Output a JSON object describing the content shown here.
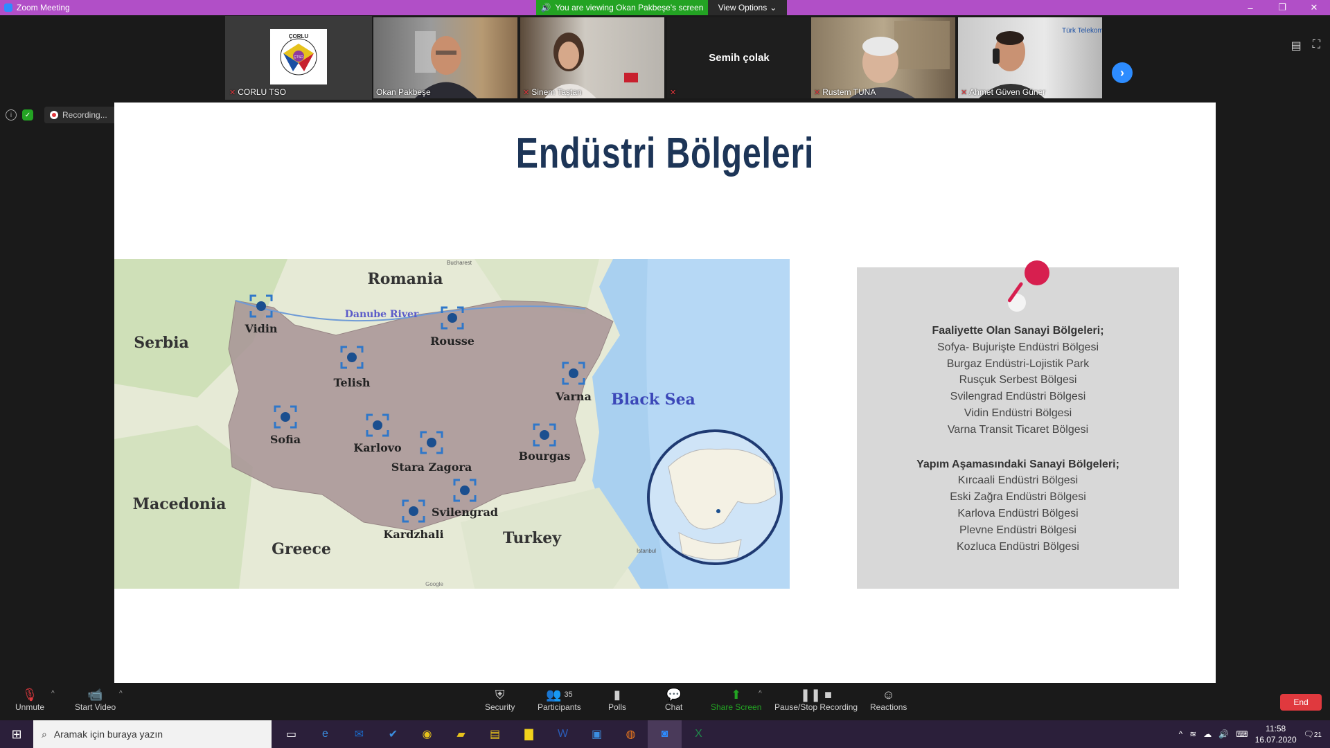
{
  "window": {
    "title": "Zoom Meeting",
    "controls": [
      "–",
      "❐",
      "✕"
    ]
  },
  "banner": {
    "viewing": "You are viewing Okan Pakbeşe's screen",
    "view_options": "View Options"
  },
  "participants": [
    {
      "name": "CORLU TSO",
      "muted": true,
      "type": "logo"
    },
    {
      "name": "Okan Pakbeşe",
      "muted": false,
      "type": "video"
    },
    {
      "name": "Sinem Taştan",
      "muted": true,
      "type": "video"
    },
    {
      "name": "Semih çolak",
      "muted": true,
      "type": "name-only"
    },
    {
      "name": "Rustem TUNA",
      "muted": true,
      "type": "video"
    },
    {
      "name": "Ahmet Güven Güner",
      "muted": true,
      "type": "video"
    }
  ],
  "logo": {
    "line1": "ÇORLU",
    "line2": "TİCARET ve SANAYİ ODASI",
    "center": "ÇTSO"
  },
  "video_overlay_text": "Türk Telekom",
  "recording": {
    "label": "Recording..."
  },
  "slide": {
    "title": "Endüstri Bölgeleri",
    "map": {
      "countries": [
        "Romania",
        "Serbia",
        "Macedonia",
        "Greece",
        "Turkey"
      ],
      "sea": "Black Sea",
      "river": "Danube River",
      "cities": [
        "Vidin",
        "Rousse",
        "Telish",
        "Varna",
        "Sofia",
        "Karlovo",
        "Stara Zagora",
        "Bourgas",
        "Svilengrad",
        "Kardzhali"
      ],
      "small_labels": [
        "Bucharest",
        "Istanbul",
        "Google"
      ]
    },
    "card": {
      "active_heading": "Faaliyette Olan Sanayi Bölgeleri;",
      "active_items": [
        "Sofya- Bujurişte Endüstri Bölgesi",
        "Burgaz Endüstri-Lojistik Park",
        "Rusçuk Serbest Bölgesi",
        "Svilengrad Endüstri Bölgesi",
        "Vidin Endüstri Bölgesi",
        "Varna Transit Ticaret Bölgesi"
      ],
      "construction_heading": "Yapım Aşamasındaki Sanayi Bölgeleri;",
      "construction_items": [
        "Kırcaali Endüstri Bölgesi",
        "Eski Zağra Endüstri Bölgesi",
        "Karlova Endüstri Bölgesi",
        "Plevne Endüstri Bölgesi",
        "Kozluca Endüstri Bölgesi"
      ]
    }
  },
  "toolbar": {
    "unmute": "Unmute",
    "start_video": "Start Video",
    "security": "Security",
    "participants": "Participants",
    "participants_count": "35",
    "polls": "Polls",
    "chat": "Chat",
    "share_screen": "Share Screen",
    "pause_stop_recording": "Pause/Stop Recording",
    "reactions": "Reactions",
    "end": "End"
  },
  "taskbar": {
    "search_placeholder": "Aramak için buraya yazın",
    "time": "11:58",
    "date": "16.07.2020",
    "notifications": "21"
  },
  "colors": {
    "titlebar": "#b14fc7",
    "banner_green": "#23a323",
    "slide_title": "#1d3557",
    "pin": "#d71f4f",
    "end_button": "#e0393e",
    "zoom_blue": "#2d8cff"
  }
}
